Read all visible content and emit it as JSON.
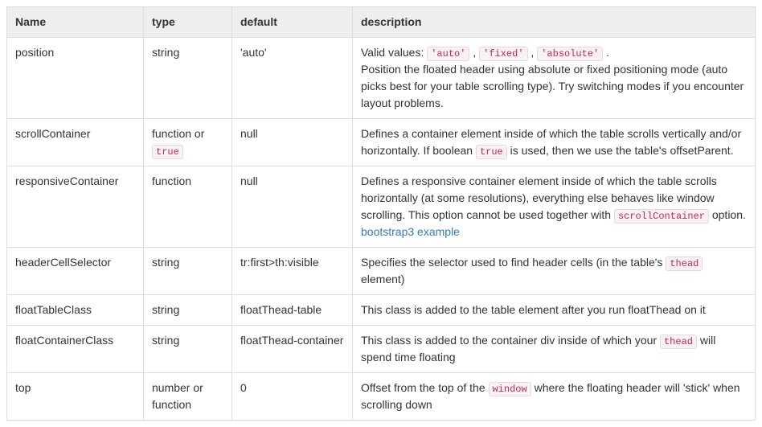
{
  "headers": {
    "name": "Name",
    "type": "type",
    "default": "default",
    "description": "description"
  },
  "rows": {
    "position": {
      "name": "position",
      "type": "string",
      "default": "'auto'",
      "desc_prefix": "Valid values: ",
      "desc_code1": "'auto'",
      "desc_sep1": " , ",
      "desc_code2": "'fixed'",
      "desc_sep2": " , ",
      "desc_code3": "'absolute'",
      "desc_after_codes": " .",
      "desc_line2": "Position the floated header using absolute or fixed positioning mode (auto picks best for your table scrolling type). Try switching modes if you encounter layout problems."
    },
    "scrollContainer": {
      "name": "scrollContainer",
      "type_pre": "function or ",
      "type_code": "true",
      "default": "null",
      "desc_pre": "Defines a container element inside of which the table scrolls vertically and/or horizontally. If boolean ",
      "desc_code": "true",
      "desc_post": " is used, then we use the table's offsetParent."
    },
    "responsiveContainer": {
      "name": "responsiveContainer",
      "type": "function",
      "default": "null",
      "desc_pre": "Defines a responsive container element inside of which the table scrolls horizontally (at some resolutions), everything else behaves like window scrolling. This option cannot be used together with ",
      "desc_code": "scrollContainer",
      "desc_mid": " option. ",
      "desc_link": "bootstrap3 example"
    },
    "headerCellSelector": {
      "name": "headerCellSelector",
      "type": "string",
      "default": "tr:first>th:visible",
      "desc_pre": "Specifies the selector used to find header cells (in the table's ",
      "desc_code": "thead",
      "desc_post": " element)"
    },
    "floatTableClass": {
      "name": "floatTableClass",
      "type": "string",
      "default": "floatThead-table",
      "desc": "This class is added to the table element after you run floatThead on it"
    },
    "floatContainerClass": {
      "name": "floatContainerClass",
      "type": "string",
      "default": "floatThead-container",
      "desc_pre": "This class is added to the container div inside of which your ",
      "desc_code": "thead",
      "desc_post": " will spend time floating"
    },
    "top": {
      "name": "top",
      "type": "number or function",
      "default": "0",
      "desc_pre": "Offset from the top of the ",
      "desc_code": "window",
      "desc_post": " where the floating header will 'stick' when scrolling down"
    }
  }
}
